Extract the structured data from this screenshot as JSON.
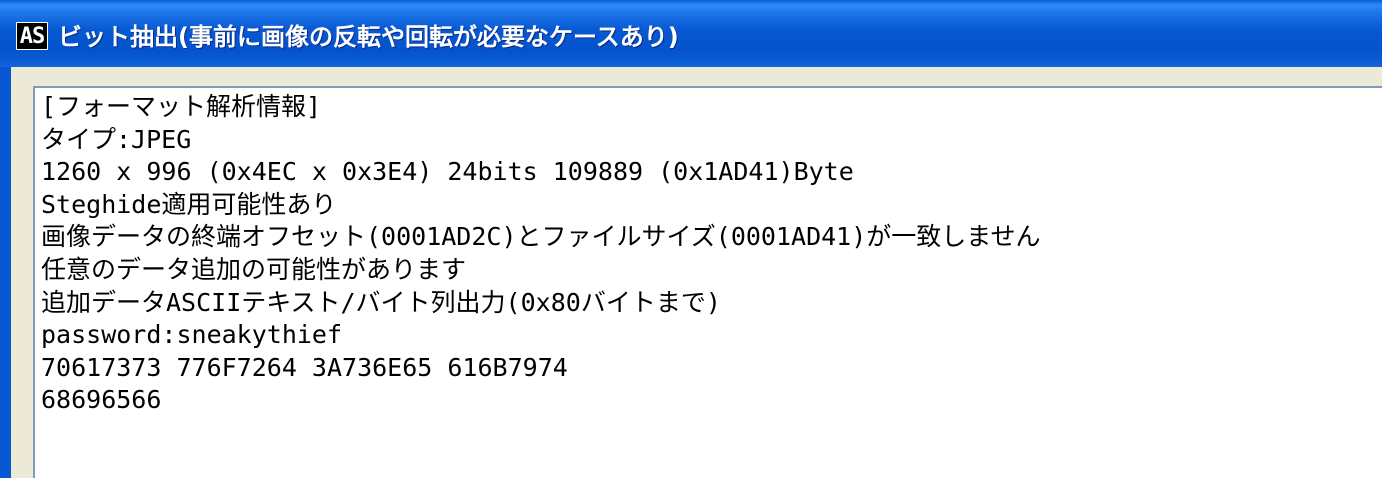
{
  "window": {
    "icon_text": "AS",
    "title": "ビット抽出(事前に画像の反転や回転が必要なケースあり)"
  },
  "output": {
    "lines": [
      "[フォーマット解析情報]",
      "タイプ:JPEG",
      "1260 x 996 (0x4EC x 0x3E4)  24bits  109889 (0x1AD41)Byte",
      "Steghide適用可能性あり",
      "画像データの終端オフセット(0001AD2C)とファイルサイズ(0001AD41)が一致しません",
      "任意のデータ追加の可能性があります",
      "追加データASCIIテキスト/バイト列出力(0x80バイトまで)",
      "password:sneakythief",
      "70617373 776F7264 3A736E65 616B7974",
      "68696566"
    ]
  },
  "colors": {
    "titlebar": "#0758d2",
    "window_bg": "#ece9d8",
    "textbox_bg": "#ffffff",
    "text": "#000000"
  }
}
